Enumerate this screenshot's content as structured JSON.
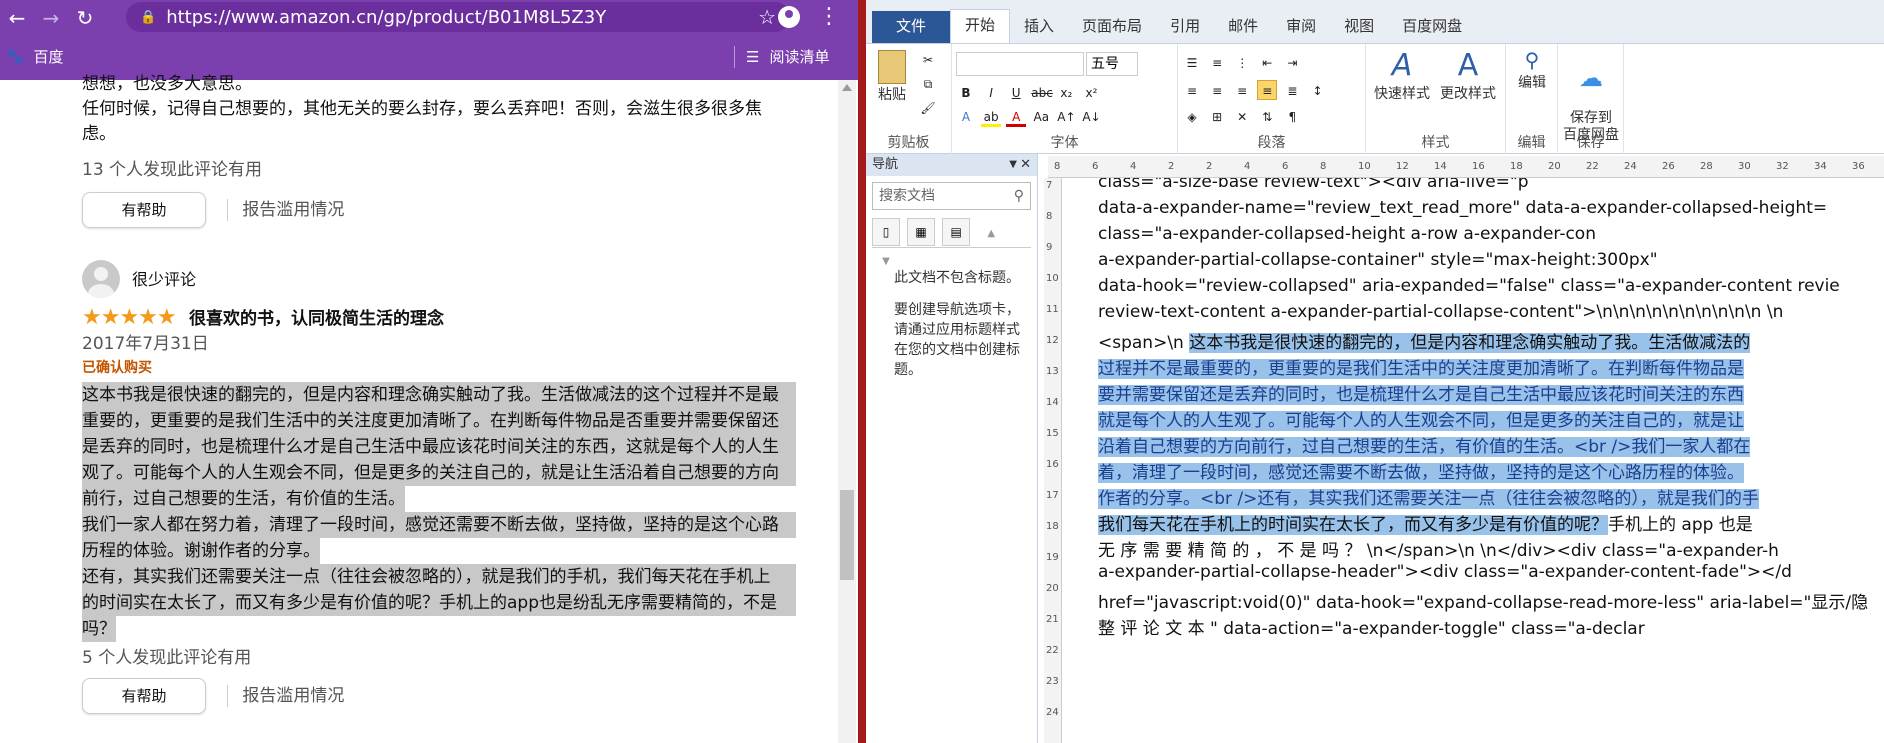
{
  "browser": {
    "url": "https://www.amazon.cn/gp/product/B01M8L5Z3Y",
    "bookmark": "百度",
    "reading_list": "阅读清单"
  },
  "page": {
    "prev_lines": [
      "想想，也没多大意思。",
      "任何时候，记得自己想要的，其他无关的要么封存，要么丢弃吧！否则，会滋生很多很多焦",
      "虑。"
    ],
    "review1_helpful": "13 个人发现此评论有用",
    "helpful_btn": "有帮助",
    "report_abuse": "报告滥用情况",
    "reviewer": "很少评论",
    "stars": "★★★★★",
    "rating_value": 5,
    "review_title": "很喜欢的书，认同极简生活的理念",
    "review_date": "2017年7月31日",
    "verified": "已确认购买",
    "review_body": [
      "这本书我是很快速的翻完的，但是内容和理念确实触动了我。生活做减法的这个过程并不是最",
      "重要的，更重要的是我们生活中的关注度更加清晰了。在判断每件物品是否重要并需要保留还",
      "是丢弃的同时，也是梳理什么才是自己生活中最应该花时间关注的东西，这就是每个人的人生",
      "观了。可能每个人的人生观会不同，但是更多的关注自己的，就是让生活沿着自己想要的方向",
      "前行，过自己想要的生活，有价值的生活。",
      "我们一家人都在努力着，清理了一段时间，感觉还需要不断去做，坚持做，坚持的是这个心路",
      "历程的体验。谢谢作者的分享。",
      "还有，其实我们还需要关注一点（往往会被忽略的），就是我们的手机，我们每天花在手机上",
      "的时间实在太长了，而又有多少是有价值的呢？手机上的app也是纷乱无序需要精简的，不是",
      "吗？"
    ],
    "review2_helpful": "5 个人发现此评论有用"
  },
  "word": {
    "tabs": [
      "文件",
      "开始",
      "插入",
      "页面布局",
      "引用",
      "邮件",
      "审阅",
      "视图",
      "百度网盘"
    ],
    "font_size": "五号",
    "groups": [
      "剪贴板",
      "字体",
      "段落",
      "样式",
      "编辑",
      "保存"
    ],
    "paste": "粘贴",
    "quick_styles": "快速样式",
    "change_styles": "更改样式",
    "edit": "编辑",
    "save_to_baidu": "保存到\n百度网盘",
    "nav_title": "导航",
    "nav_search": "搜索文档",
    "nav_msg1": "此文档不包含标题。",
    "nav_msg2": "要创建导航选项卡，请通过应用标题样式在您的文档中创建标题。",
    "ruler_nums": [
      "8",
      "6",
      "4",
      "2",
      "2",
      "4",
      "6",
      "8",
      "10",
      "12",
      "14",
      "16",
      "18",
      "20",
      "22",
      "24",
      "26",
      "28",
      "30",
      "32",
      "34",
      "36"
    ],
    "vruler_nums": [
      "7",
      "8",
      "9",
      "10",
      "11",
      "12",
      "13",
      "14",
      "15",
      "16",
      "17",
      "18",
      "19",
      "20",
      "21",
      "22",
      "23",
      "24"
    ],
    "doc_lines": [
      {
        "t": "class=\"a-size-base                    review-text\"><div                    aria-live=\"p",
        "h": false
      },
      {
        "t": "data-a-expander-name=\"review_text_read_more\"          data-a-expander-collapsed-height=",
        "h": false
      },
      {
        "t": "class=\"a-expander-collapsed-height                   a-row                  a-expander-con",
        "h": false
      },
      {
        "t": "a-expander-partial-collapse-container\"                          style=\"max-height:300px\"",
        "h": false
      },
      {
        "t": "data-hook=\"review-collapsed\"     aria-expanded=\"false\"     class=\"a-expander-content     revie",
        "h": false
      },
      {
        "t": "review-text-content     a-expander-partial-collapse-content\">\\n\\n\\n\\n\\n\\n\\n\\n\\n\\n          \\n",
        "h": false
      },
      {
        "t": "<span>\\n    ",
        "h": false,
        "ht": "这本书我是很快速的翻完的，但是内容和理念确实触动了我。生活做减法的"
      },
      {
        "t": "",
        "h": true,
        "ht": "过程并不是最重要的，更重要的是我们生活中的关注度更加清晰了。在判断每件物品是"
      },
      {
        "t": "",
        "h": true,
        "ht": "要并需要保留还是丢弃的同时，也是梳理什么才是自己生活中最应该花时间关注的东西"
      },
      {
        "t": "",
        "h": true,
        "ht": "就是每个人的人生观了。可能每个人的人生观会不同，但是更多的关注自己的，就是让"
      },
      {
        "t": "",
        "h": true,
        "ht": "沿着自己想要的方向前行，过自己想要的生活，有价值的生活。<br />我们一家人都在"
      },
      {
        "t": "",
        "h": true,
        "ht": "着，清理了一段时间，感觉还需要不断去做，坚持做，坚持的是这个心路历程的体验。"
      },
      {
        "t": "",
        "h": true,
        "ht": "作者的分享。<br />还有，其实我们还需要关注一点（往往会被忽略的），就是我们的手"
      },
      {
        "t": "手机上的 app 也是",
        "h": false,
        "ht": "我们每天花在手机上的时间实在太长了，而又有多少是有价值的呢？",
        "after": true
      },
      {
        "t": "无 序 需 要 精 简 的 ， 不 是 吗 ？   \\n</span>\\n       \\n</div><div    class=\"a-expander-h",
        "h": false
      },
      {
        "t": "a-expander-partial-collapse-header\"><div             class=\"a-expander-content-fade\"></d",
        "h": false
      },
      {
        "t": "href=\"javascript:void(0)\"  data-hook=\"expand-collapse-read-more-less\"  aria-label=\"显示/隐",
        "h": false
      },
      {
        "t": "整      评      论      文      本      \"      data-action=\"a-expander-toggle\"      class=\"a-declar",
        "h": false
      }
    ]
  }
}
